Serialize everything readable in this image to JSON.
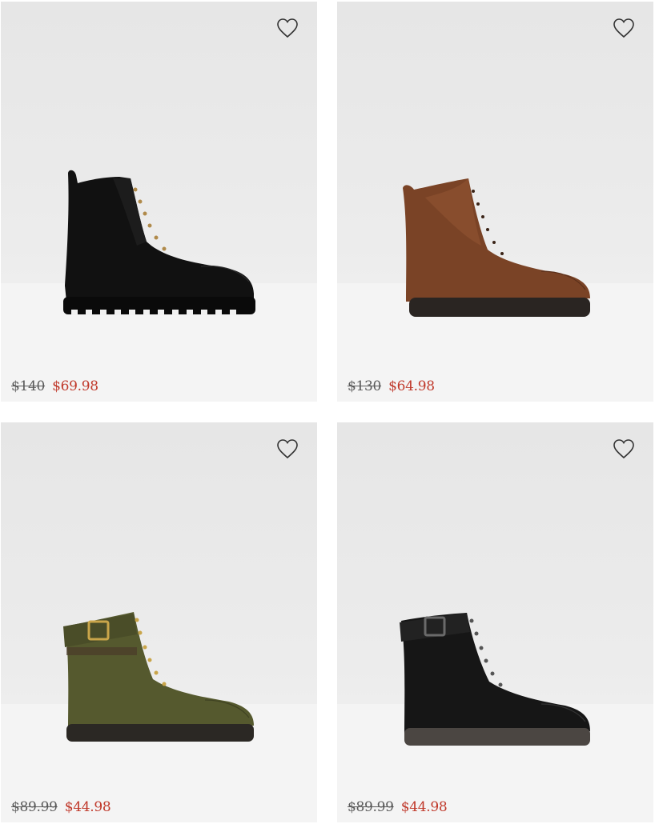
{
  "products": [
    {
      "name_icon": "black-lace-up-combat-boot",
      "original_price": "$140",
      "sale_price": "$69.98",
      "wishlist_icon": "heart-outline-icon"
    },
    {
      "name_icon": "brown-lace-up-leather-boot",
      "original_price": "$130",
      "sale_price": "$64.98",
      "wishlist_icon": "heart-outline-icon"
    },
    {
      "name_icon": "olive-buckle-lace-up-boot",
      "original_price": "$89.99",
      "sale_price": "$44.98",
      "wishlist_icon": "heart-outline-icon"
    },
    {
      "name_icon": "black-buckle-lace-up-boot",
      "original_price": "$89.99",
      "sale_price": "$44.98",
      "wishlist_icon": "heart-outline-icon"
    }
  ],
  "colors": {
    "sale_price": "#c0392b",
    "original_price": "#5a5a5a",
    "card_background": "#e9e9e9"
  }
}
